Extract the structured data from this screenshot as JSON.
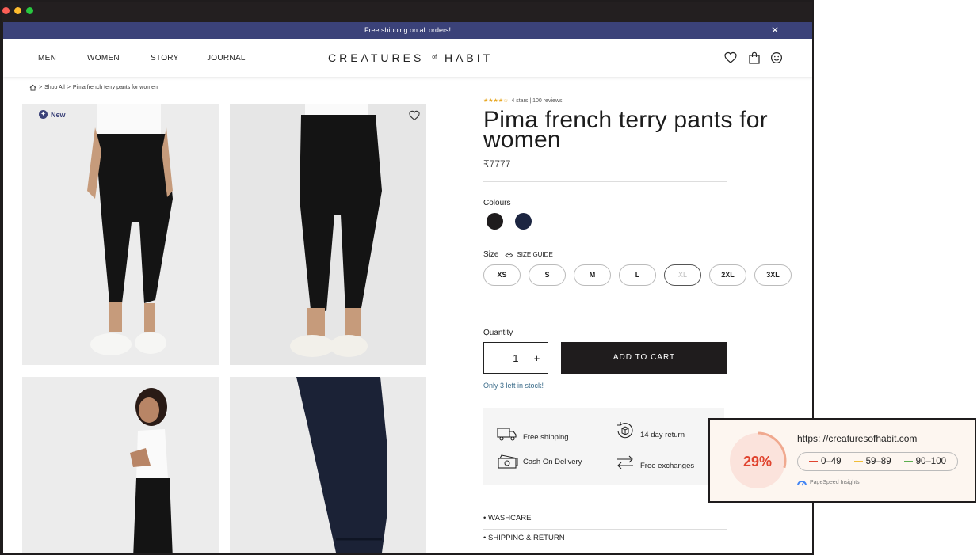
{
  "announcement": {
    "text": "Free shipping on all orders!",
    "close": "✕"
  },
  "nav": {
    "links": [
      "MEN",
      "WOMEN",
      "STORY",
      "JOURNAL"
    ],
    "logo_left": "CREATURES",
    "logo_mid": "of",
    "logo_right": "HABIT"
  },
  "breadcrumb": {
    "items": [
      "Shop All",
      "Pima french terry pants for women"
    ],
    "sep": ">"
  },
  "gallery": {
    "badge": "New"
  },
  "product": {
    "stars": "★★★★☆",
    "rating_text": "4 stars | 100 reviews",
    "title": "Pima french terry pants for women",
    "price": "₹7777",
    "colours_label": "Colours",
    "colours": [
      "#1f1c1d",
      "#1c2541"
    ],
    "size_label": "Size",
    "size_guide": "SIZE GUIDE",
    "sizes": [
      "XS",
      "S",
      "M",
      "L",
      "XL",
      "2XL",
      "3XL"
    ],
    "quantity_label": "Quantity",
    "quantity": "1",
    "minus": "–",
    "plus": "+",
    "add_to_cart": "ADD TO CART",
    "stock": "Only 3 left in stock!",
    "perks": [
      "Free shipping",
      "14 day return",
      "Cash On Delivery",
      "Free exchanges"
    ],
    "accordion": [
      "• WASHCARE",
      "• SHIPPING & RETURN"
    ]
  },
  "pagespeed": {
    "score": "29%",
    "score_value": 0.29,
    "url": "https: //creaturesofhabit.com",
    "legend": [
      "0–49",
      "59–89",
      "90–100"
    ],
    "brand": "PageSpeed Insights",
    "colors": {
      "bad": "#e0442f",
      "avg": "#f0bd37",
      "good": "#5cae4f"
    }
  }
}
